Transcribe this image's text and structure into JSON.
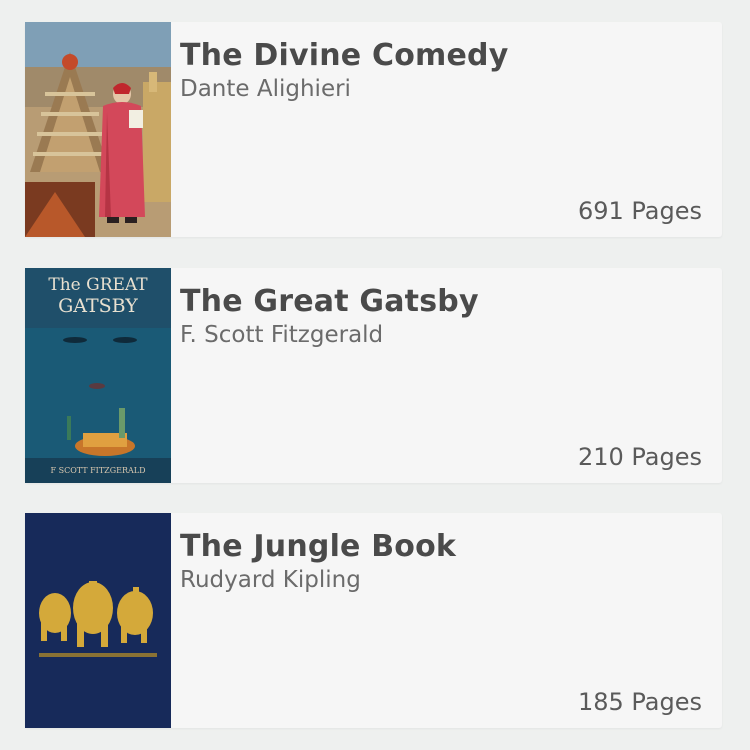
{
  "books": [
    {
      "title": "The Divine Comedy",
      "author": "Dante Alighieri",
      "pages": "691 Pages",
      "cover_icon": "divine-comedy-cover-painting"
    },
    {
      "title": "The Great Gatsby",
      "author": "F. Scott Fitzgerald",
      "pages": "210 Pages",
      "cover_icon": "great-gatsby-cover-art",
      "cover_text_top": "The GREAT",
      "cover_text_bottom": "GATSBY",
      "cover_footer": "F SCOTT FITZGERALD"
    },
    {
      "title": "The Jungle Book",
      "author": "Rudyard Kipling",
      "pages": "185 Pages",
      "cover_icon": "jungle-book-elephants-cover"
    }
  ],
  "colors": {
    "background": "#eef0ef",
    "card": "#f6f6f6",
    "title": "#4a4a4a",
    "author": "#6b6b6b",
    "pages": "#5a5a5a"
  }
}
